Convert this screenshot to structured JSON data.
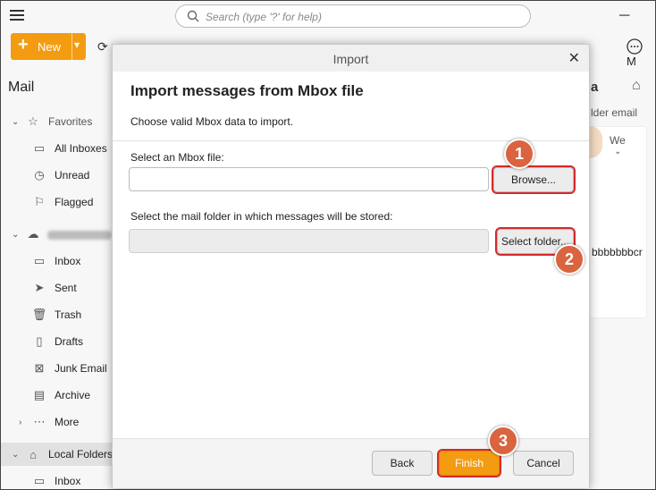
{
  "search": {
    "placeholder": "Search (type '?' for help)"
  },
  "toolbar": {
    "new_label": "New",
    "more_label": "M"
  },
  "sidebar": {
    "title": "Mail",
    "favorites": "Favorites",
    "favorite_items": [
      "All Inboxes",
      "Unread",
      "Flagged"
    ],
    "account_items": [
      "Inbox",
      "Sent",
      "Trash",
      "Drafts",
      "Junk Email",
      "Archive",
      "More"
    ],
    "local_folders": "Local Folders",
    "local_items": [
      "Inbox"
    ]
  },
  "right_pane": {
    "header_fragment": "a",
    "folder_email": "lder email",
    "we_fragment": "We",
    "body_fragment": "bbbbbbbcr"
  },
  "dialog": {
    "title": "Import",
    "heading": "Import messages from Mbox file",
    "subtitle": "Choose valid Mbox data to import.",
    "mbox_label": "Select an Mbox file:",
    "mbox_value": "",
    "browse_label": "Browse...",
    "folder_label": "Select the mail folder in which messages will be stored:",
    "folder_value": "",
    "select_folder_label": "Select folder...",
    "back_label": "Back",
    "finish_label": "Finish",
    "cancel_label": "Cancel"
  },
  "annotations": [
    "1",
    "2",
    "3"
  ],
  "colors": {
    "accent": "#f39c12",
    "highlight": "#d52a2a",
    "marker": "#d9643f"
  }
}
